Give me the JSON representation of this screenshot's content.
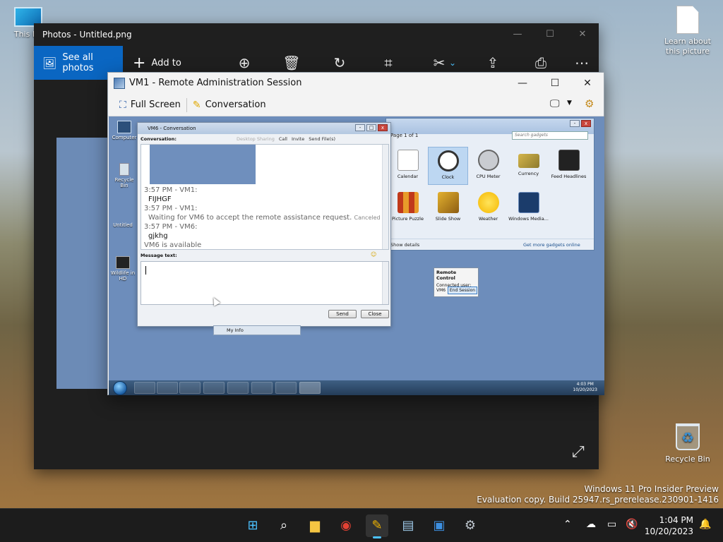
{
  "desktop": {
    "top_left_icon_label": "This PC",
    "learn_icon_label": "Learn about this picture",
    "recycle_label": "Recycle Bin",
    "watermark_line1": "Windows 11 Pro Insider Preview",
    "watermark_line2": "Evaluation copy. Build 25947.rs_prerelease.230901-1416"
  },
  "photos": {
    "title": "Photos - Untitled.png",
    "see_all": "See all photos",
    "add_to": "Add to"
  },
  "vm": {
    "title": "VM1 - Remote Administration Session",
    "full_screen": "Full Screen",
    "conversation": "Conversation"
  },
  "guest": {
    "icons": [
      "Computer",
      "Recycle Bin",
      "Untitled",
      "Wildlife in HD"
    ],
    "gadgets": {
      "page": "Page 1 of 1",
      "search_placeholder": "Search gadgets",
      "items": [
        "Calendar",
        "Clock",
        "CPU Meter",
        "Currency",
        "Feed Headlines",
        "Picture Puzzle",
        "Slide Show",
        "Weather",
        "Windows Media...",
        ""
      ],
      "show_details": "Show details",
      "online": "Get more gadgets online"
    },
    "remote_control": {
      "title": "Remote Control",
      "user": "Connected user: VM6",
      "end_button": "End Session"
    },
    "conversation": {
      "title": "VM6 - Conversation",
      "label": "Conversation:",
      "actions": [
        "Desktop Sharing",
        "Call",
        "Invite",
        "Send File(s)"
      ],
      "messages": [
        {
          "who": "3:57 PM - VM1:",
          "text": "FIJHGF"
        },
        {
          "who": "3:57 PM - VM1:",
          "text": "Waiting for VM6 to accept the remote assistance request.",
          "tag": "Canceled"
        },
        {
          "who": "3:57 PM - VM6:",
          "text": "gjkhg"
        }
      ],
      "status": "VM6 is available",
      "message_label": "Message text:",
      "send": "Send",
      "close": "Close",
      "my_info": "My Info"
    },
    "clock_time": "4:03 PM",
    "clock_date": "10/20/2023"
  },
  "taskbar": {
    "time": "1:04 PM",
    "date": "10/20/2023"
  },
  "colors": {
    "accent": "#0a66c2",
    "guest_desktop": "#6d8dbb"
  }
}
